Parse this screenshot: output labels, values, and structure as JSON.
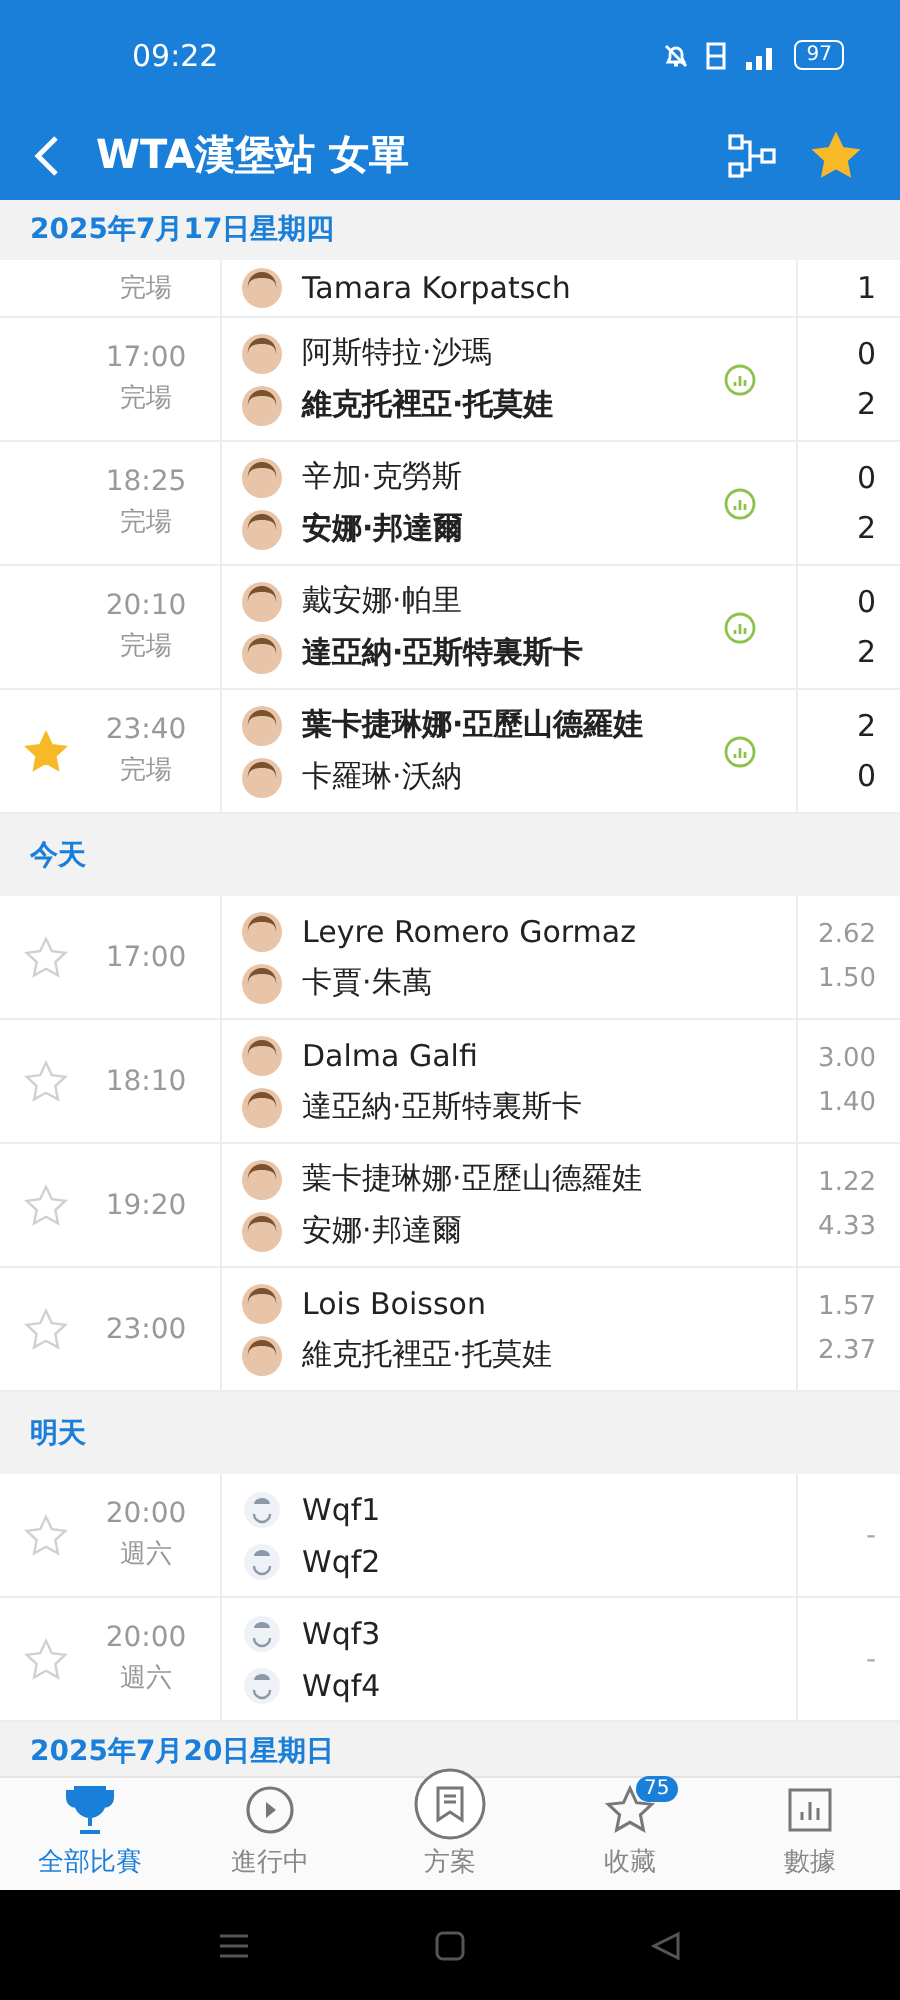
{
  "status_bar": {
    "time": "09:22",
    "battery": "97"
  },
  "header": {
    "title": "WTA漢堡站 女單",
    "favorite": true
  },
  "sections": [
    {
      "label": "2025年7月17日星期四",
      "matches": [
        {
          "kind": "result",
          "favorite": false,
          "status": "完場",
          "players": [
            {
              "name": "Tamara Korpatsch",
              "winner": false,
              "score": "1"
            }
          ]
        },
        {
          "kind": "result",
          "favorite": false,
          "time": "17:00",
          "status": "完場",
          "players": [
            {
              "name": "阿斯特拉·沙瑪",
              "winner": false,
              "score": "0"
            },
            {
              "name": "維克托裡亞·托莫娃",
              "winner": true,
              "score": "2"
            }
          ]
        },
        {
          "kind": "result",
          "favorite": false,
          "time": "18:25",
          "status": "完場",
          "players": [
            {
              "name": "辛加·克勞斯",
              "winner": false,
              "score": "0"
            },
            {
              "name": "安娜·邦達爾",
              "winner": true,
              "score": "2"
            }
          ]
        },
        {
          "kind": "result",
          "favorite": false,
          "time": "20:10",
          "status": "完場",
          "players": [
            {
              "name": "戴安娜·帕里",
              "winner": false,
              "score": "0"
            },
            {
              "name": "達亞納·亞斯特裏斯卡",
              "winner": true,
              "score": "2"
            }
          ]
        },
        {
          "kind": "result",
          "favorite": true,
          "time": "23:40",
          "status": "完場",
          "players": [
            {
              "name": "葉卡捷琳娜·亞歷山德羅娃",
              "winner": true,
              "score": "2"
            },
            {
              "name": "卡羅琳·沃納",
              "winner": false,
              "score": "0"
            }
          ]
        }
      ]
    },
    {
      "label": "今天",
      "matches": [
        {
          "kind": "odds",
          "favorite": false,
          "time": "17:00",
          "players": [
            {
              "name": "Leyre Romero Gormaz",
              "odds": "2.62"
            },
            {
              "name": "卡賈·朱萬",
              "odds": "1.50"
            }
          ]
        },
        {
          "kind": "odds",
          "favorite": false,
          "time": "18:10",
          "players": [
            {
              "name": "Dalma Galfi",
              "odds": "3.00"
            },
            {
              "name": "達亞納·亞斯特裏斯卡",
              "odds": "1.40"
            }
          ]
        },
        {
          "kind": "odds",
          "favorite": false,
          "time": "19:20",
          "players": [
            {
              "name": "葉卡捷琳娜·亞歷山德羅娃",
              "odds": "1.22"
            },
            {
              "name": "安娜·邦達爾",
              "odds": "4.33"
            }
          ]
        },
        {
          "kind": "odds",
          "favorite": false,
          "time": "23:00",
          "players": [
            {
              "name": "Lois Boisson",
              "odds": "1.57"
            },
            {
              "name": "維克托裡亞·托莫娃",
              "odds": "2.37"
            }
          ]
        }
      ]
    },
    {
      "label": "明天",
      "matches": [
        {
          "kind": "scheduled",
          "favorite": false,
          "time": "20:00",
          "status": "週六",
          "players": [
            {
              "name": "Wqf1"
            },
            {
              "name": "Wqf2"
            }
          ],
          "mark": "-"
        },
        {
          "kind": "scheduled",
          "favorite": false,
          "time": "20:00",
          "status": "週六",
          "players": [
            {
              "name": "Wqf3"
            },
            {
              "name": "Wqf4"
            }
          ],
          "mark": "-"
        }
      ]
    },
    {
      "label": "2025年7月20日星期日"
    }
  ],
  "nav": [
    {
      "label": "全部比賽",
      "selected": true
    },
    {
      "label": "進行中",
      "selected": false
    },
    {
      "label": "方案",
      "selected": false
    },
    {
      "label": "收藏",
      "selected": false,
      "badge": "75"
    },
    {
      "label": "數據",
      "selected": false
    }
  ]
}
